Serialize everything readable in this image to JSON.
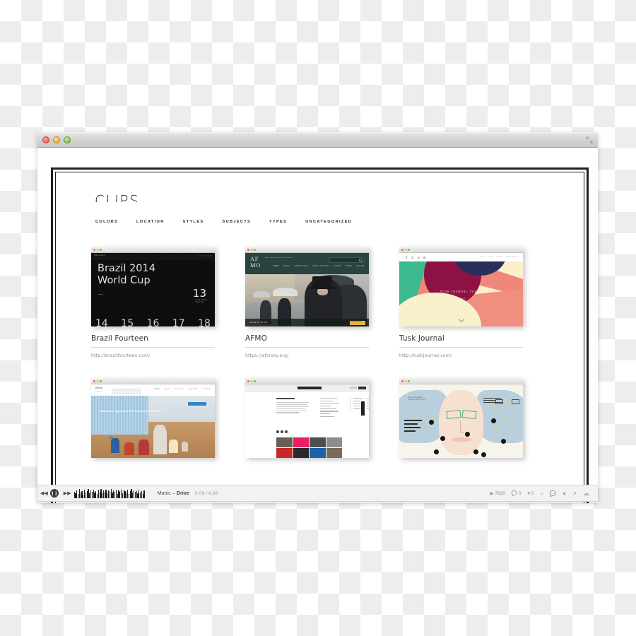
{
  "window": {
    "traffic_lights": [
      "close",
      "minimize",
      "maximize"
    ],
    "fullscreen_icon": "fullscreen-icon"
  },
  "site": {
    "logo": "CLIPS",
    "nav": [
      {
        "label": "COLORS"
      },
      {
        "label": "LOCATION"
      },
      {
        "label": "STYLES"
      },
      {
        "label": "SUBJECTS"
      },
      {
        "label": "TYPES"
      },
      {
        "label": "UNCATEGORIZED"
      }
    ]
  },
  "cards": [
    {
      "title": "Brazil Fourteen",
      "url": "http://brazilfourteen.com/",
      "thumb": {
        "kind": "brazil",
        "topbar_left": "Brazil 2014",
        "topbar_right": "17 18 19",
        "headline_line1": "Brazil 2014",
        "headline_line2": "World Cup",
        "dash": "—",
        "big_number": "13",
        "big_caption": "Group of Match\\nWorld Cup",
        "day_numbers": [
          "14",
          "15",
          "16",
          "17",
          "18"
        ],
        "bg_color": "#0e0e0e"
      }
    },
    {
      "title": "AFMO",
      "url": "https://aforsay.org/",
      "thumb": {
        "kind": "afmo",
        "logo_line1": "AF",
        "logo_line2": "MO",
        "tagline": "American Federation of Museums",
        "menu": [
          "HOME",
          "ABOUT",
          "EXHIBITIONS",
          "VISUAL HISTORY",
          "EVENTS",
          "NEWS",
          "DONATE"
        ],
        "caption": "Orsay in the US",
        "button_label": "READ MORE",
        "header_color": "#294340",
        "button_color": "#e4b83c"
      }
    },
    {
      "title": "Tusk Journal",
      "url": "http://tuskjournal.com/",
      "thumb": {
        "kind": "tusk",
        "brand": "T U S K",
        "links": [
          "home",
          "shop",
          "journal",
          "about/contact"
        ],
        "hero_title": "TUSK JOURNAL VOL. 1",
        "hero_sub": "explore",
        "palette": {
          "green": "#3cb98d",
          "maroon": "#8e1145",
          "coral": "#f0887a",
          "cream": "#faf0cc",
          "navy": "#28305a"
        }
      }
    },
    {
      "title": "",
      "url": "",
      "thumb": {
        "kind": "education",
        "brand": "DMJoo",
        "brand_sub": "Studio Works",
        "menu": [
          "HOME",
          "ABOUT",
          "PROJECT",
          "PARTNER",
          "CONTACT"
        ],
        "headline": "Education System & Workshop for Children"
      }
    },
    {
      "title": "",
      "url": "",
      "thumb": {
        "kind": "editorial",
        "heading": "EDITORIAL 01"
      }
    },
    {
      "title": "",
      "url": "",
      "thumb": {
        "kind": "face",
        "title_line1": "Emilie Beaulieu",
        "title_line2": "Drawing Exhibition"
      }
    }
  ],
  "player": {
    "prev_icon": "skip-previous-icon",
    "pause_icon": "pause-icon",
    "next_icon": "skip-next-icon",
    "waveform_icon": "waveform",
    "track_artist": "Manic",
    "track_separator": "–",
    "track_title": "Drive",
    "time": "0.09 / 4.39",
    "plays_icon": "play-count-icon",
    "plays": "7828",
    "comments_icon": "comment-count-icon",
    "comments": "0",
    "likes_icon": "like-count-icon",
    "likes": "0",
    "share_icon": "share-icon",
    "comment_icon": "comment-icon",
    "heart_icon": "heart-icon",
    "repost_icon": "repost-icon",
    "soundcloud_icon": "soundcloud-cloud-icon"
  }
}
